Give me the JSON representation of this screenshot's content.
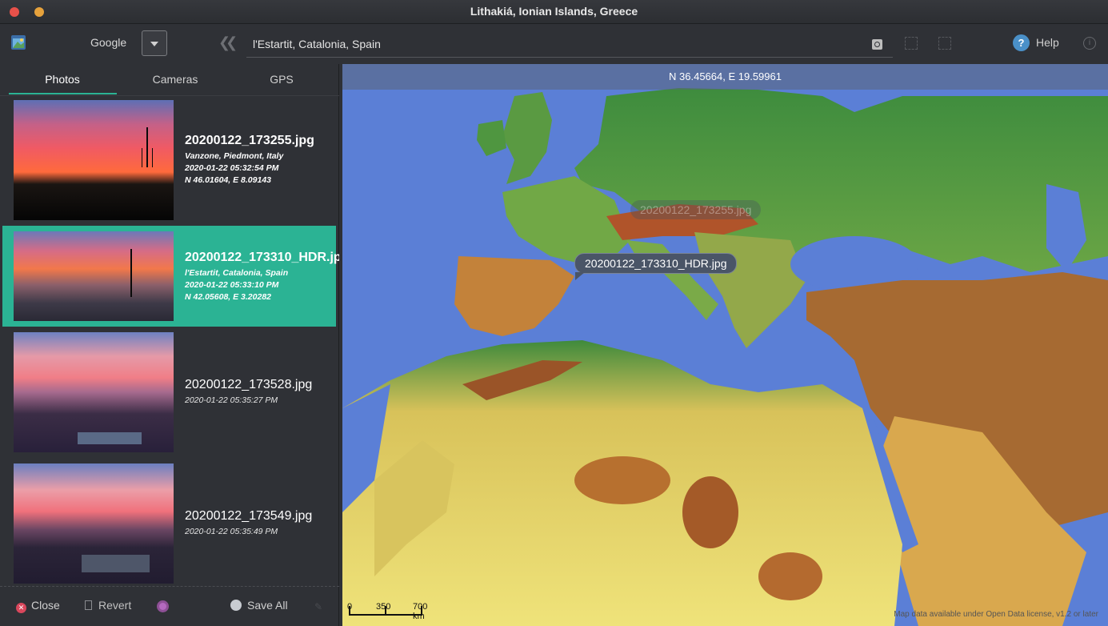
{
  "window": {
    "title": "Lithakiá, Ionian Islands, Greece"
  },
  "toolbar": {
    "provider": "Google",
    "search_value": "l'Estartit, Catalonia, Spain",
    "help_label": "Help"
  },
  "tabs": [
    {
      "label": "Photos",
      "active": true
    },
    {
      "label": "Cameras",
      "active": false
    },
    {
      "label": "GPS",
      "active": false
    }
  ],
  "photos": [
    {
      "name": "20200122_173255.jpg",
      "location": "Vanzone, Piedmont, Italy",
      "datetime": "2020-01-22 05:32:54 PM",
      "coords": "N 46.01604, E 8.09143",
      "selected": false
    },
    {
      "name": "20200122_173310_HDR.jpg",
      "location": "l'Estartit, Catalonia, Spain",
      "datetime": "2020-01-22 05:33:10 PM",
      "coords": "N 42.05608, E 3.20282",
      "selected": true
    },
    {
      "name": "20200122_173528.jpg",
      "datetime": "2020-01-22 05:35:27 PM",
      "selected": false
    },
    {
      "name": "20200122_173549.jpg",
      "datetime": "2020-01-22 05:35:49 PM",
      "selected": false
    }
  ],
  "bottom": {
    "close_label": "Close",
    "revert_label": "Revert",
    "save_all_label": "Save All"
  },
  "map": {
    "coords_readout": "N 36.45664, E 19.59961",
    "selected_marker": "20200122_173310_HDR.jpg",
    "faded_marker": "20200122_173255.jpg",
    "scale_labels": [
      "0",
      "350",
      "700 km"
    ],
    "attribution": "Map data available under Open Data license, v1.2 or later"
  },
  "colors": {
    "accent": "#2bb394",
    "close_red": "#e8514a",
    "minimize": "#e6a23c"
  }
}
